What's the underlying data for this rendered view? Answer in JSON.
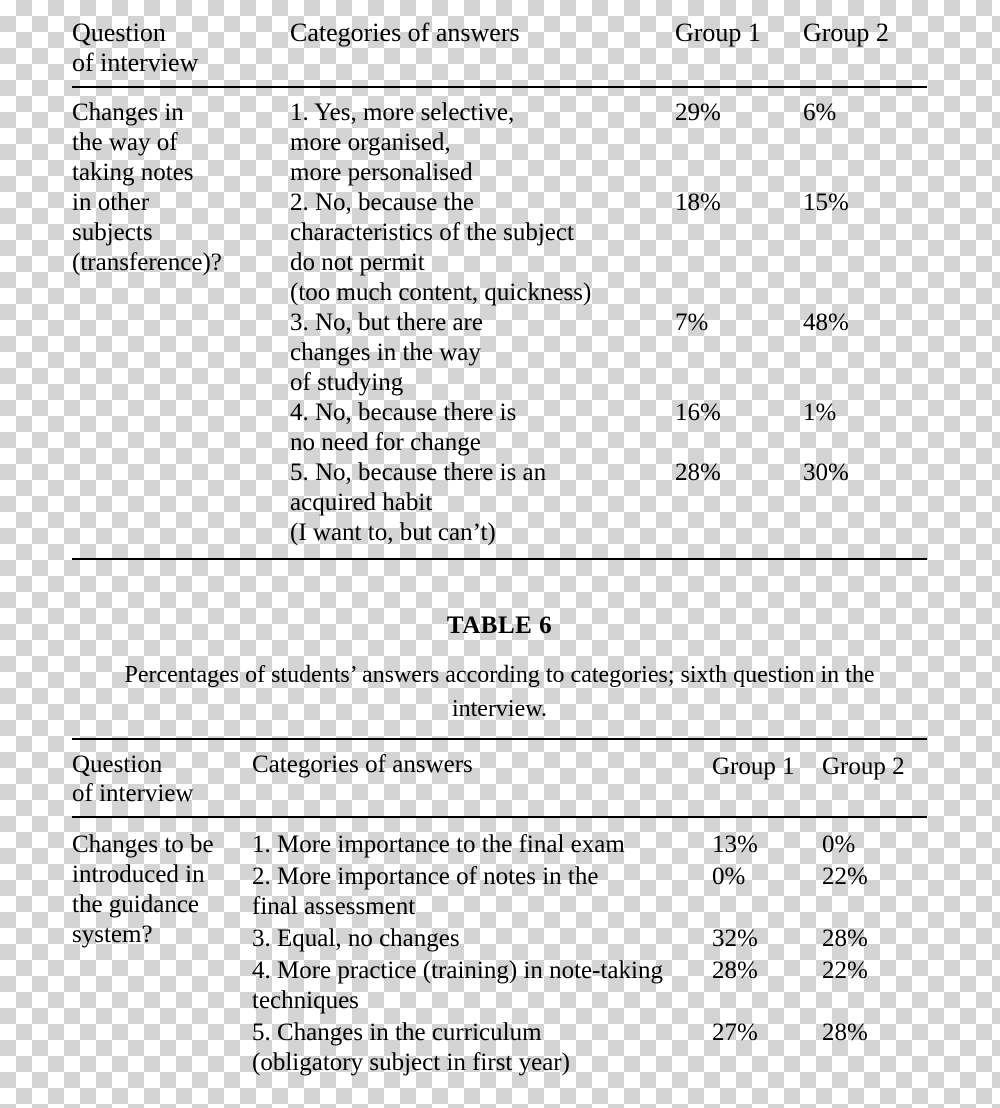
{
  "table5": {
    "headers": {
      "question": "Question\nof interview",
      "question_line1": "Question",
      "question_line2": "of interview",
      "categories": "Categories of answers",
      "group1": "Group 1",
      "group2": "Group 2"
    },
    "question": {
      "lines": [
        "Changes in",
        "the way of",
        "taking notes",
        "in other",
        "subjects",
        "(transference)?"
      ]
    },
    "rows": [
      {
        "category_lines": [
          "1. Yes, more selective,",
          "more organised,",
          "more personalised"
        ],
        "group1": "29%",
        "group2": "6%"
      },
      {
        "category_lines": [
          "2. No, because the",
          "characteristics of the subject",
          "do not permit",
          "(too much content, quickness)"
        ],
        "group1": "18%",
        "group2": "15%"
      },
      {
        "category_lines": [
          "3. No, but there are",
          "changes in the way",
          "of studying"
        ],
        "group1": "7%",
        "group2": "48%"
      },
      {
        "category_lines": [
          "4. No, because there is",
          "no need for change"
        ],
        "group1": "16%",
        "group2": "1%"
      },
      {
        "category_lines": [
          "5. No, because there is an",
          "acquired habit",
          "(I want to, but can’t)"
        ],
        "group1": "28%",
        "group2": "30%"
      }
    ]
  },
  "caption": {
    "label": "TABLE 6",
    "text_line1": "Percentages of students’ answers according to categories; sixth question in the",
    "text_line2": "interview."
  },
  "table6": {
    "headers": {
      "question_line1": "Question",
      "question_line2": "of interview",
      "categories": "Categories of answers",
      "group1": "Group 1",
      "group2": "Group 2"
    },
    "question": {
      "lines": [
        "Changes to be",
        "introduced in",
        "the guidance",
        "system?"
      ]
    },
    "rows": [
      {
        "category_lines": [
          "1. More importance to the final exam"
        ],
        "group1": "13%",
        "group2": "0%"
      },
      {
        "category_lines": [
          "2. More importance of notes in the",
          "final assessment"
        ],
        "group1": "0%",
        "group2": "22%"
      },
      {
        "category_lines": [
          "3. Equal, no changes"
        ],
        "group1": "32%",
        "group2": "28%"
      },
      {
        "category_lines": [
          "4. More practice (training) in note-taking",
          "techniques"
        ],
        "group1": "28%",
        "group2": "22%"
      },
      {
        "category_lines": [
          "5. Changes in the curriculum",
          "(obligatory subject in first year)"
        ],
        "group1": "27%",
        "group2": "28%"
      }
    ]
  }
}
